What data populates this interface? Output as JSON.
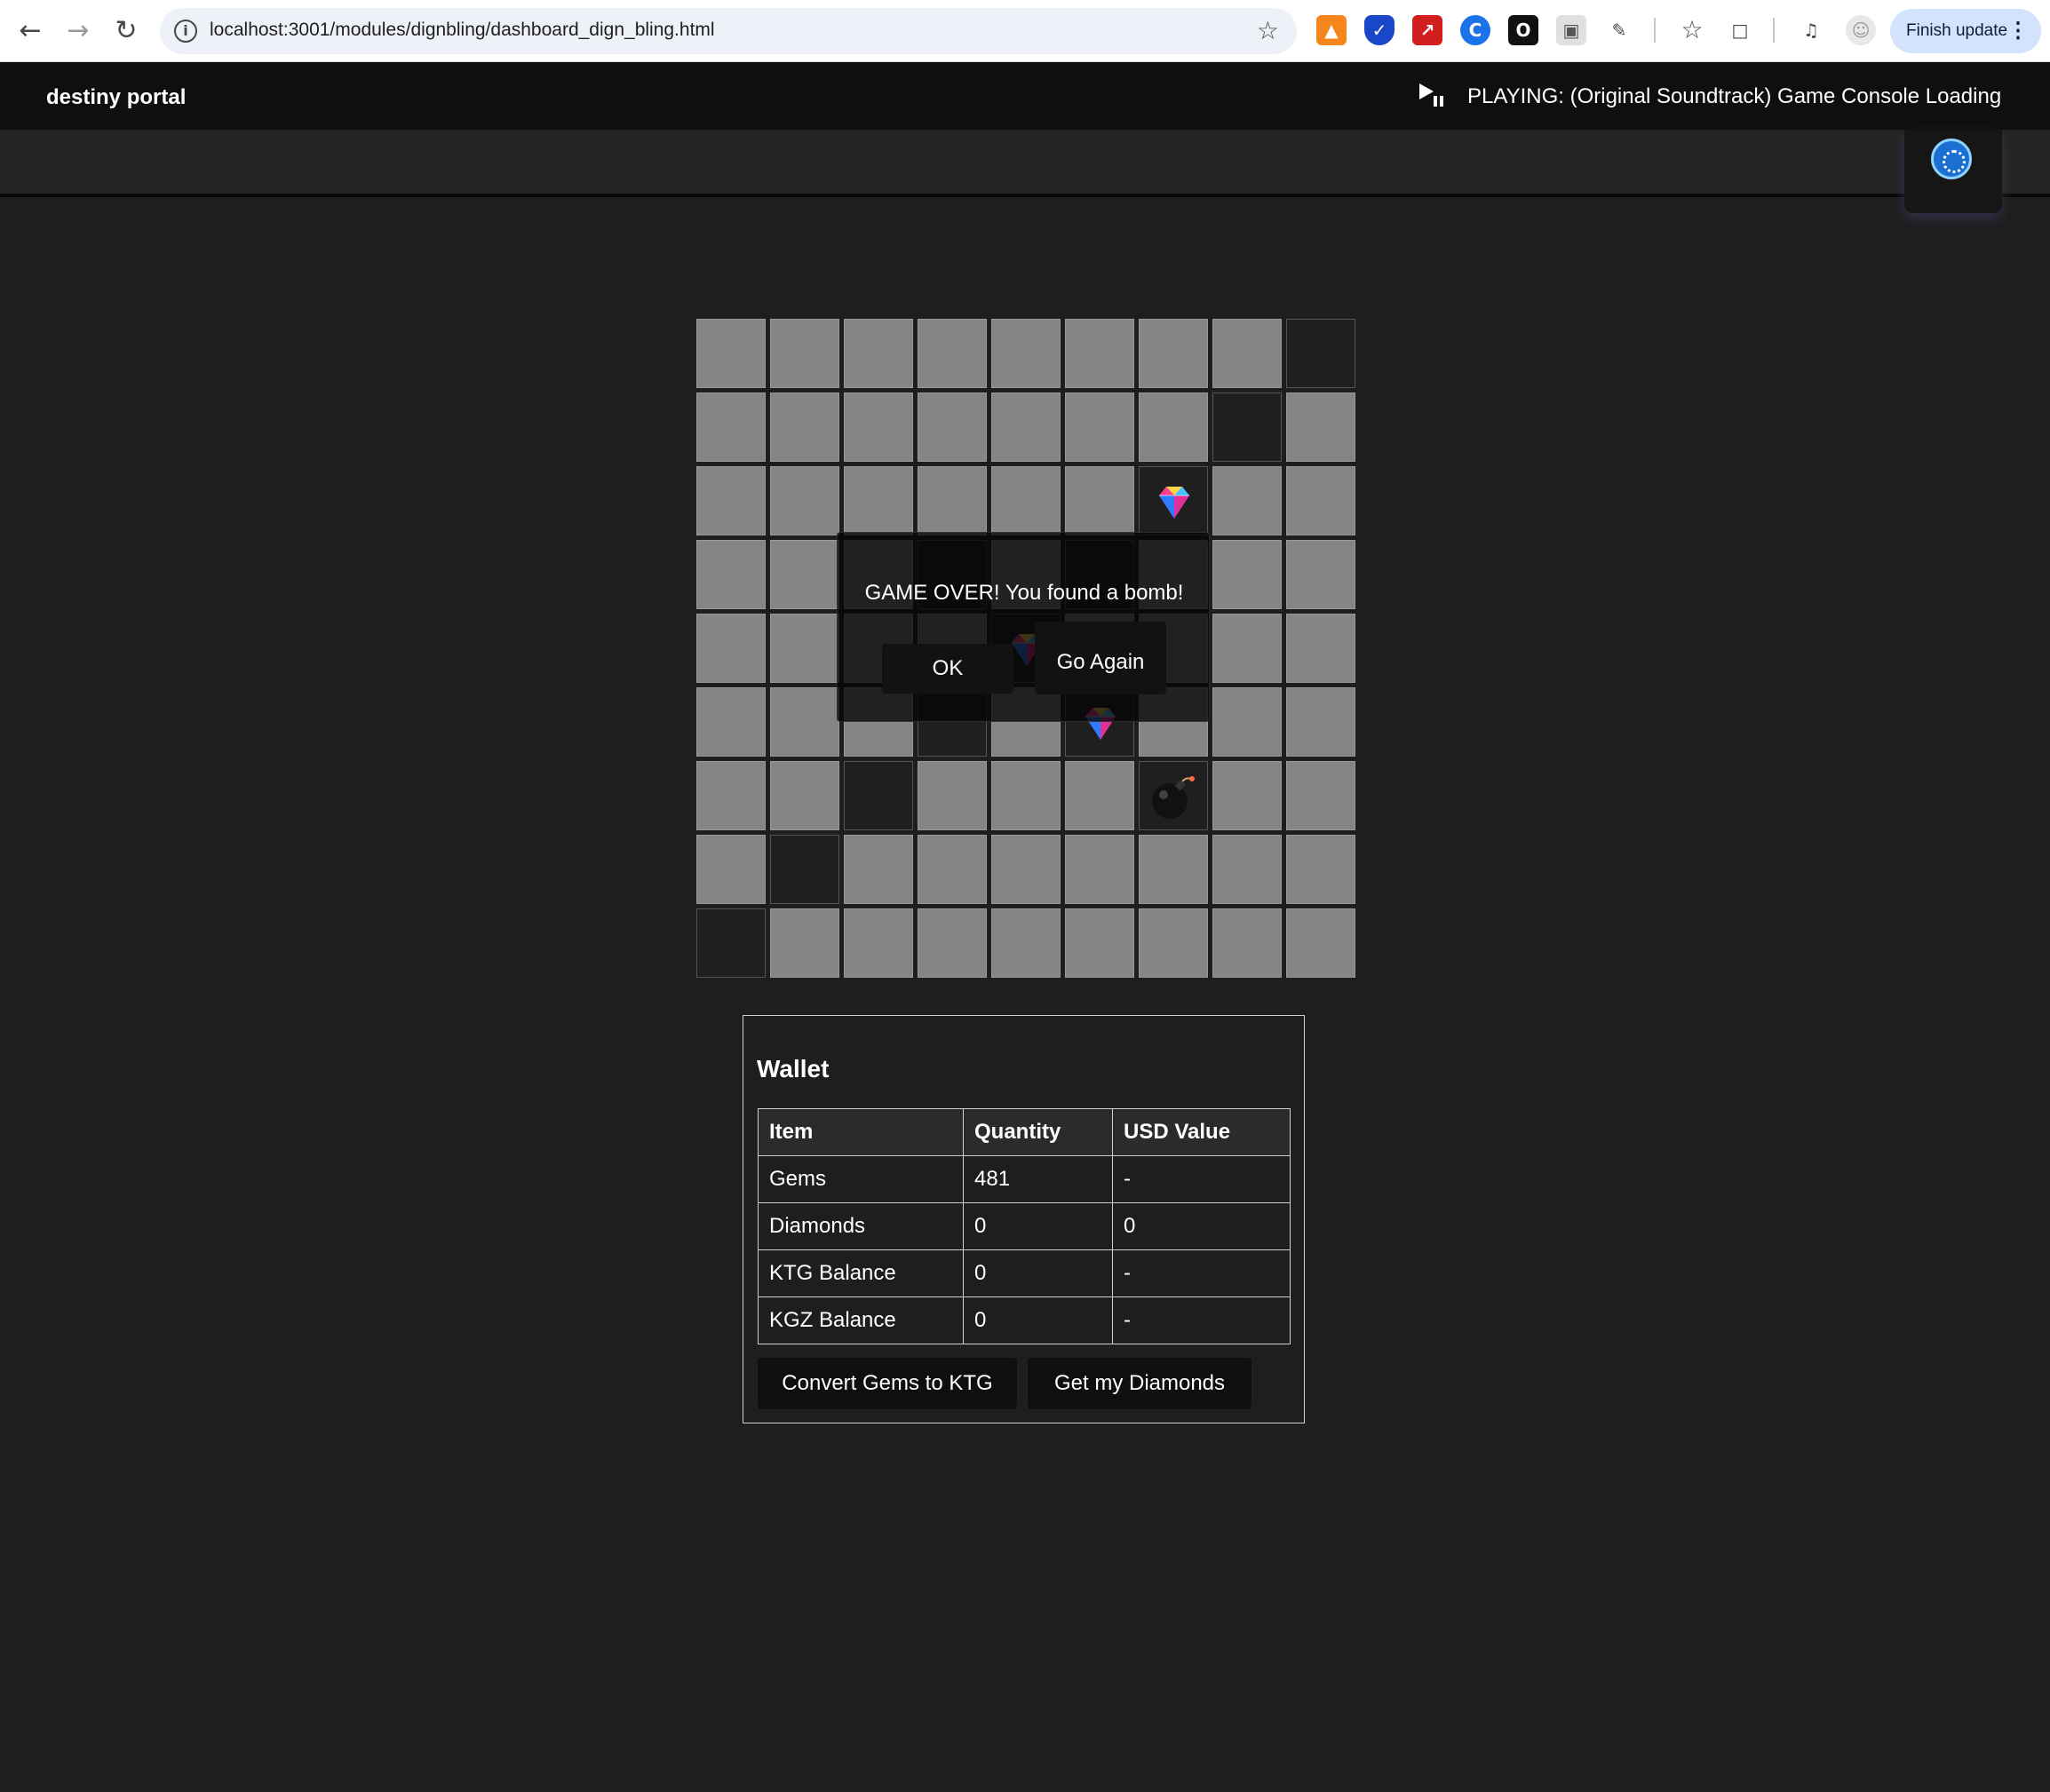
{
  "browser": {
    "url": "localhost:3001/modules/dignbling/dashboard_dign_bling.html",
    "finish_update_label": "Finish update"
  },
  "header": {
    "brand": "destiny portal",
    "now_playing": "PLAYING: (Original Soundtrack) Game Console Loading"
  },
  "game": {
    "rows": 9,
    "cols": 9,
    "cells": [
      {
        "row": 0,
        "col": 8,
        "state": "revealed",
        "content": "empty"
      },
      {
        "row": 1,
        "col": 7,
        "state": "revealed",
        "content": "empty"
      },
      {
        "row": 2,
        "col": 6,
        "state": "revealed",
        "content": "gem"
      },
      {
        "row": 3,
        "col": 3,
        "state": "revealed",
        "content": "empty"
      },
      {
        "row": 3,
        "col": 5,
        "state": "revealed",
        "content": "empty"
      },
      {
        "row": 4,
        "col": 4,
        "state": "revealed",
        "content": "gem"
      },
      {
        "row": 5,
        "col": 3,
        "state": "revealed",
        "content": "empty"
      },
      {
        "row": 5,
        "col": 5,
        "state": "revealed",
        "content": "gem"
      },
      {
        "row": 6,
        "col": 2,
        "state": "revealed",
        "content": "empty"
      },
      {
        "row": 6,
        "col": 6,
        "state": "revealed",
        "content": "bomb"
      },
      {
        "row": 7,
        "col": 1,
        "state": "revealed",
        "content": "empty"
      },
      {
        "row": 8,
        "col": 0,
        "state": "revealed",
        "content": "empty"
      }
    ],
    "modal": {
      "message": "GAME OVER! You found a bomb!",
      "ok_label": "OK",
      "go_again_label": "Go Again"
    }
  },
  "wallet": {
    "title": "Wallet",
    "columns": [
      "Item",
      "Quantity",
      "USD Value"
    ],
    "rows": [
      [
        "Gems",
        "481",
        "-"
      ],
      [
        "Diamonds",
        "0",
        "0"
      ],
      [
        "KTG Balance",
        "0",
        "-"
      ],
      [
        "KGZ Balance",
        "0",
        "-"
      ]
    ],
    "convert_label": "Convert Gems to KTG",
    "diamonds_label": "Get my Diamonds"
  },
  "colors": {
    "page_bg": "#1e1e1e",
    "hidden_cell": "#858585",
    "revealed_cell": "#1f1f1f",
    "header_bg": "#0f0f0f"
  }
}
